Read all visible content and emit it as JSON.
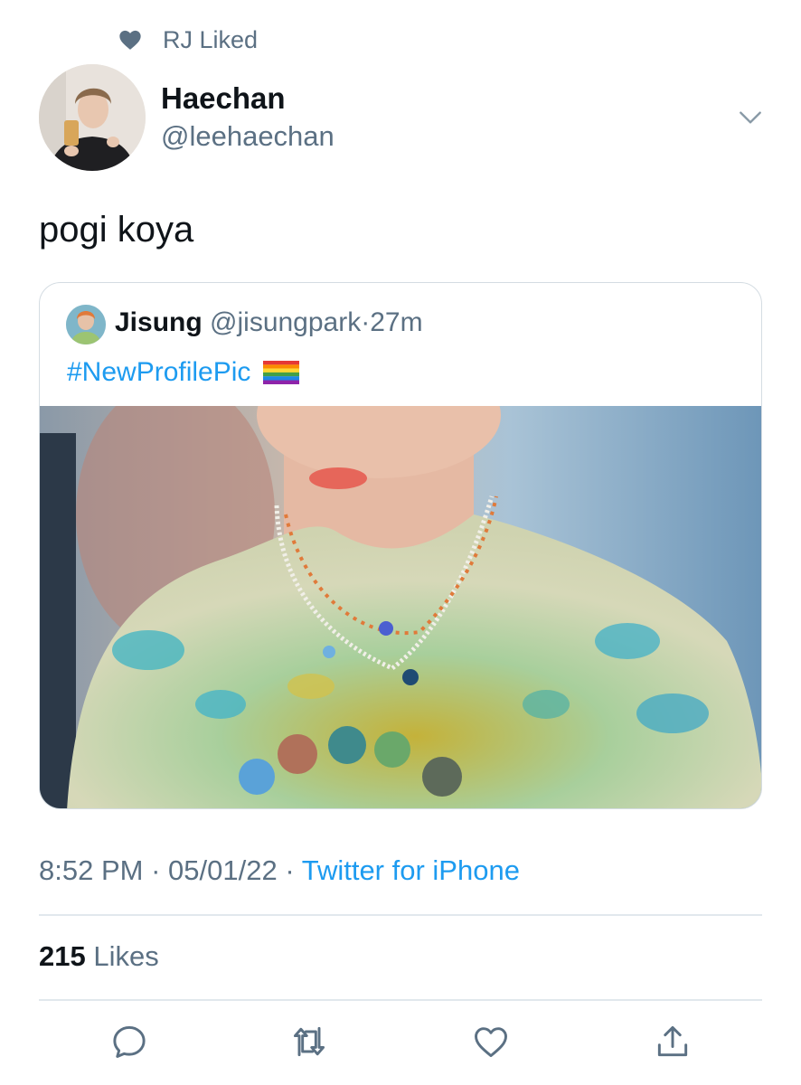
{
  "social_context": {
    "icon": "heart-icon",
    "text": "RJ Liked"
  },
  "author": {
    "display_name": "Haechan",
    "handle": "@leehaechan"
  },
  "tweet_text": "pogi koya",
  "quoted_tweet": {
    "display_name": "Jisung",
    "handle": "@jisungpark",
    "separator": "·",
    "time": "27m",
    "text": "#NewProfilePic"
  },
  "meta": {
    "time": "8:52 PM",
    "sep1": "·",
    "date": "05/01/22",
    "sep2": "·",
    "source": "Twitter for iPhone"
  },
  "stats": {
    "likes_count": "215",
    "likes_label": "Likes"
  },
  "actions": [
    "reply-icon",
    "retweet-icon",
    "like-icon",
    "share-icon"
  ],
  "colors": {
    "link": "#1d9bf0",
    "secondary": "#5b7083",
    "border": "#d4dce2"
  }
}
